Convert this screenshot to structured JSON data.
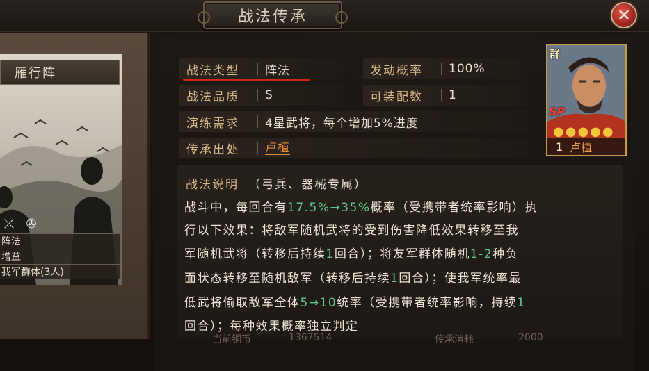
{
  "window": {
    "title": "战法传承",
    "close_icon": "close-icon"
  },
  "left_panel": {
    "tactic_name": "雁行阵",
    "icons": [
      "bow-crossbow-icon",
      "wheel-icon"
    ],
    "rows": [
      "阵法",
      "增益",
      "我军群体(3人)"
    ]
  },
  "info": {
    "type_label": "战法类型",
    "type_value": "阵法",
    "quality_label": "战法品质",
    "quality_value": "S",
    "requirement_label": "演练需求",
    "requirement_value": "4星武将，每个增加5%进度",
    "source_label": "传承出处",
    "source_value": "卢植",
    "rate_label": "发动概率",
    "rate_value": "100%",
    "equip_label": "可装配数",
    "equip_value": "1"
  },
  "general_card": {
    "faction": "群",
    "badge": "SP",
    "stars": 5,
    "level": "1",
    "name": "卢植",
    "accent_color": "#c59a4a"
  },
  "description": {
    "header": "战法说明",
    "note": "（弓兵、器械专属）",
    "line1_a": "战斗中，每回合有",
    "line1_hl": "17.5%→35%",
    "line1_b": "概率（受携带者统率影响）执",
    "line2": "行以下效果：将敌军随机武将的受到伤害降低效果转移至我",
    "line3_a": "军随机武将（转移后持续",
    "line3_hl1": "1",
    "line3_b": "回合）；将友军群体随机",
    "line3_hl2": "1-2",
    "line3_c": "种负",
    "line4_a": "面状态转移至随机敌军（转移后持续",
    "line4_hl": "1",
    "line4_b": "回合）；使我军统率最",
    "line5_a": "低武将偷取敌军全体",
    "line5_hl": "5→10",
    "line5_b": "统率（受携带者统率影响，持续",
    "line5_hl2": "1",
    "line6": "回合）；每种效果概率独立判定",
    "highlight_color": "#5ec98a"
  },
  "bottom_partial": {
    "left": "当前铜币",
    "left_value": "1367514",
    "right": "传承消耗",
    "right_value": "2000"
  }
}
